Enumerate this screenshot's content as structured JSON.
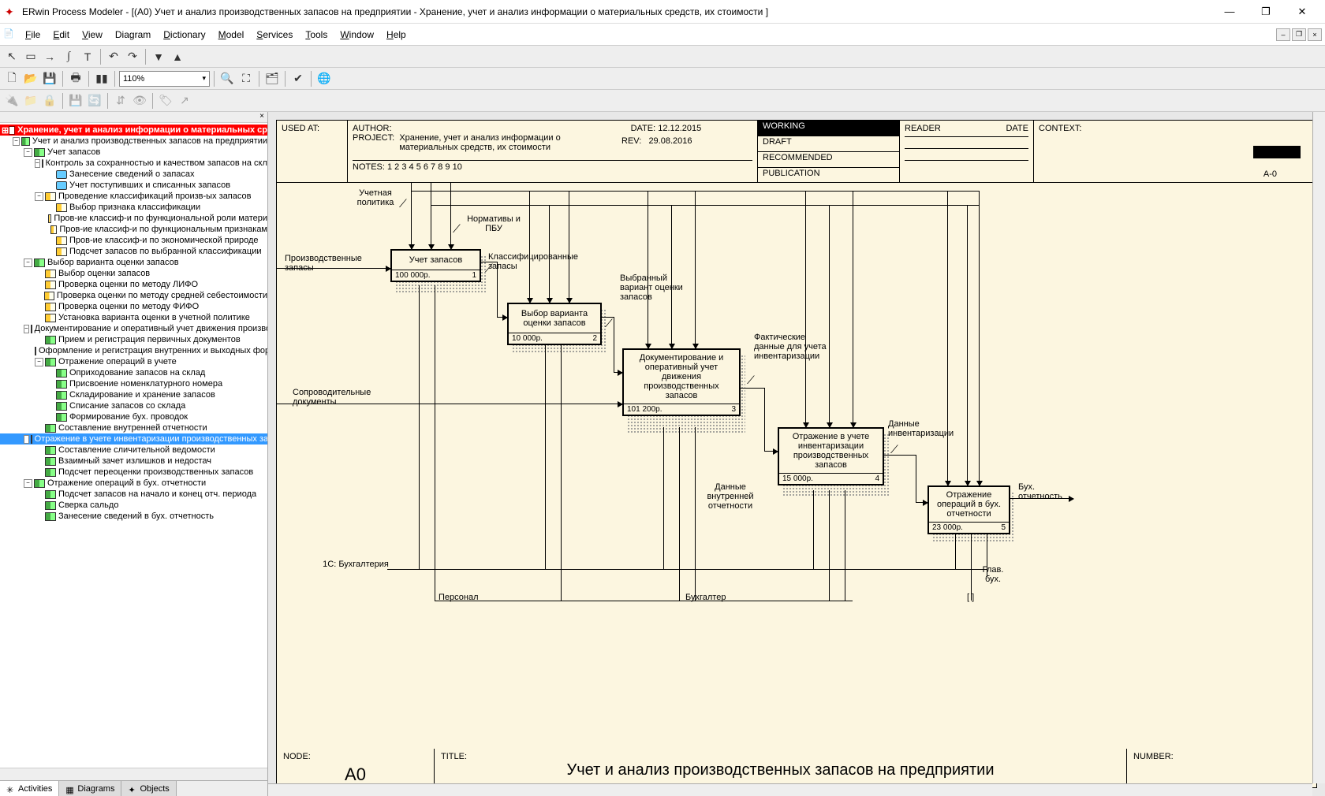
{
  "app": {
    "title": "ERwin Process Modeler - [(A0) Учет и анализ производственных запасов на предприятии - Хранение, учет и анализ информации о материальных средств, их стоимости ]"
  },
  "menu": {
    "file": "File",
    "edit": "Edit",
    "view": "View",
    "diagram": "Diagram",
    "dictionary": "Dictionary",
    "model": "Model",
    "services": "Services",
    "tools": "Tools",
    "window": "Window",
    "help": "Help"
  },
  "toolbar": {
    "zoom": "110%"
  },
  "tree_tabs": {
    "activities": "Activities",
    "diagrams": "Diagrams",
    "objects": "Objects"
  },
  "tree": {
    "root": "Хранение, учет и анализ информации о материальных ср",
    "n1": "Учет и анализ производственных запасов на предприятии",
    "n2": "Учет запасов",
    "n3": "Контроль за сохранностью и качеством запасов на скла",
    "n4": "Занесение сведений о запасах",
    "n5": "Учет поступивших и списанных запасов",
    "n6": "Проведение классификаций произв-ых запасов",
    "n7": "Выбор признака классификации",
    "n8": "Пров-ие классиф-и по функциональной роли матери",
    "n9": "Пров-ие классиф-и по функциональным признакам",
    "n10": "Пров-ие классиф-и по экономической природе",
    "n11": "Подсчет запасов по выбранной классификации",
    "n12": "Выбор варианта оценки запасов",
    "n13": "Выбор оценки запасов",
    "n14": "Проверка оценки по методу ЛИФО",
    "n15": "Проверка оценки по методу средней себестоимости",
    "n16": "Проверка оценки по методу ФИФО",
    "n17": "Установка варианта оценки в учетной политике",
    "n18": "Документирование и оперативный учет движения производ",
    "n19": "Прием и регистрация первичных документов",
    "n20": "Оформление и регистрация внутренних и выходных форм",
    "n21": "Отражение операций в учете",
    "n22": "Оприходование запасов на склад",
    "n23": "Присвоение номенклатурного номера",
    "n24": "Складирование и хранение запасов",
    "n25": "Списание запасов со склада",
    "n26": "Формирование бух. проводок",
    "n27": "Составление внутренней отчетности",
    "n28": "Отражение в учете инвентаризации производственных зап",
    "n29": "Составление сличительной ведомости",
    "n30": "Взаимный зачет излишков и недостач",
    "n31": "Подсчет переоценки производственных запасов",
    "n32": "Отражение операций в бух. отчетности",
    "n33": "Подсчет запасов на начало и конец отч. периода",
    "n34": "Сверка сальдо",
    "n35": "Занесение сведений в бух. отчетность"
  },
  "header": {
    "used_at": "USED AT:",
    "author_lbl": "AUTHOR:",
    "project_lbl": "PROJECT:",
    "project": "Хранение, учет и анализ информации о материальных средств, их стоимости",
    "date_lbl": "DATE:",
    "date": "12.12.2015",
    "rev_lbl": "REV:",
    "rev": "29.08.2016",
    "notes": "NOTES: 1 2 3 4 5 6 7 8 9 10",
    "working": "WORKING",
    "draft": "DRAFT",
    "recommended": "RECOMMENDED",
    "publication": "PUBLICATION",
    "reader": "READER",
    "hdate": "DATE",
    "context": "CONTEXT:",
    "context_val": "A-0"
  },
  "footer": {
    "node_lbl": "NODE:",
    "node": "A0",
    "title_lbl": "TITLE:",
    "title": "Учет и анализ производственных запасов на предприятии",
    "number_lbl": "NUMBER:"
  },
  "boxes": {
    "b1": {
      "title": "Учет запасов",
      "cost": "100 000р.",
      "num": "1"
    },
    "b2": {
      "title": "Выбор варианта оценки запасов",
      "cost": "10 000р.",
      "num": "2"
    },
    "b3": {
      "title": "Документирование и оперативный учет движения производственных запасов",
      "cost": "101 200р.",
      "num": "3"
    },
    "b4": {
      "title": "Отражение в учете инвентаризации производственных запасов",
      "cost": "15 000р.",
      "num": "4"
    },
    "b5": {
      "title": "Отражение операций в бух. отчетности",
      "cost": "23 000р.",
      "num": "5"
    }
  },
  "labels": {
    "l1": "Учетная политика",
    "l2": "Нормативы и ПБУ",
    "l3": "Производственные запасы",
    "l4": "Классифицированные запасы",
    "l5": "Выбранный вариант оценки запасов",
    "l6": "Сопроводительные документы",
    "l7": "Фактические данные для учета инвентаризации",
    "l8": "Данные инвентаризации",
    "l9": "Данные внутренней отчетности",
    "l10": "Бух. отчетность",
    "l11": "1С: Бухгалтерия",
    "l12": "Персонал",
    "l13": "Бухгалтер",
    "l14": "Глав. бух.",
    "l15": "[ ]"
  }
}
